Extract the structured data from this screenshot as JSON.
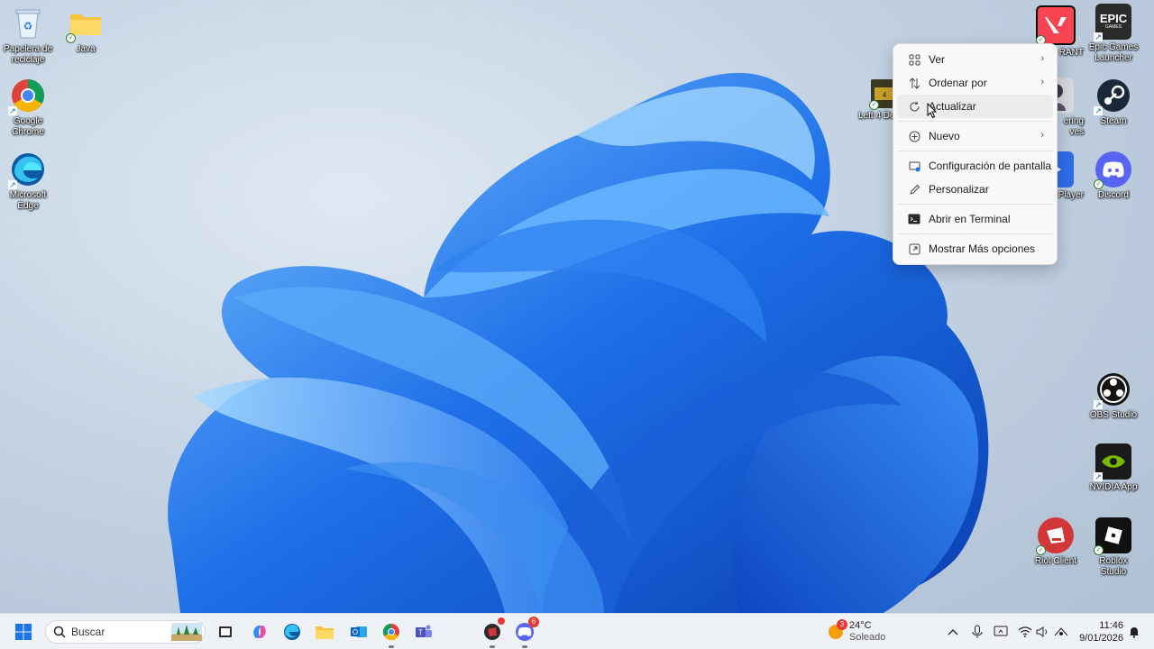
{
  "desktop": {
    "icons": [
      {
        "id": "recycle",
        "label": "Papelera de reciclaje"
      },
      {
        "id": "java",
        "label": "Java"
      },
      {
        "id": "chrome",
        "label": "Google Chrome"
      },
      {
        "id": "edge",
        "label": "Microsoft Edge"
      },
      {
        "id": "valorant",
        "label": "VALORANT",
        "visible_label": "RANT"
      },
      {
        "id": "epic",
        "label": "Epic Games Launcher"
      },
      {
        "id": "left4dead",
        "visible_label": "Left 4 De"
      },
      {
        "id": "wuthering",
        "visible_label": "ering ves"
      },
      {
        "id": "steam",
        "label": "Steam"
      },
      {
        "id": "player",
        "visible_label": "n Player"
      },
      {
        "id": "discord",
        "label": "Discord"
      },
      {
        "id": "obs",
        "label": "OBS Studio"
      },
      {
        "id": "nvidia",
        "label": "NVIDIA App"
      },
      {
        "id": "riot",
        "label": "Riot Client"
      },
      {
        "id": "roblox",
        "label": "Roblox Studio"
      }
    ],
    "epic_logo_text": "EPIC",
    "epic_logo_sub": "GAMES"
  },
  "context_menu": {
    "items": [
      {
        "label": "Ver",
        "icon": "grid-view-icon",
        "submenu": true
      },
      {
        "label": "Ordenar por",
        "icon": "sort-icon",
        "submenu": true
      },
      {
        "label": "Actualizar",
        "icon": "refresh-icon",
        "submenu": false
      },
      {
        "label": "Nuevo",
        "icon": "plus-circle-icon",
        "submenu": true
      },
      {
        "label": "Configuración de pantalla",
        "icon": "display-settings-icon",
        "submenu": false
      },
      {
        "label": "Personalizar",
        "icon": "pencil-icon",
        "submenu": false
      },
      {
        "label": "Abrir en Terminal",
        "icon": "terminal-icon",
        "submenu": false
      },
      {
        "label": "Mostrar Más opciones",
        "icon": "more-options-icon",
        "submenu": false
      }
    ],
    "chevron": "›"
  },
  "taskbar": {
    "search_placeholder": "Buscar",
    "apps": [
      {
        "id": "file-explorer-small",
        "icon": "task-view-icon"
      },
      {
        "id": "copilot",
        "icon": "copilot-icon"
      },
      {
        "id": "edge",
        "icon": "edge-icon"
      },
      {
        "id": "explorer",
        "icon": "folder-icon"
      },
      {
        "id": "outlook",
        "icon": "outlook-icon"
      },
      {
        "id": "chrome",
        "icon": "chrome-icon"
      },
      {
        "id": "teams",
        "icon": "teams-icon"
      },
      {
        "id": "riot-running",
        "icon": "riot-client-icon"
      },
      {
        "id": "discord",
        "icon": "discord-icon",
        "badge": "6"
      }
    ],
    "weather": {
      "badge": "3",
      "temp": "24°C",
      "condition": "Soleado"
    },
    "clock": {
      "time": "11:46",
      "date": "9/01/2026"
    }
  },
  "colors": {
    "accent_blue": "#1a73e8",
    "discord": "#5865f2",
    "nvidia": "#76b900",
    "riot": "#d13639",
    "valorant": "#fa4454"
  }
}
